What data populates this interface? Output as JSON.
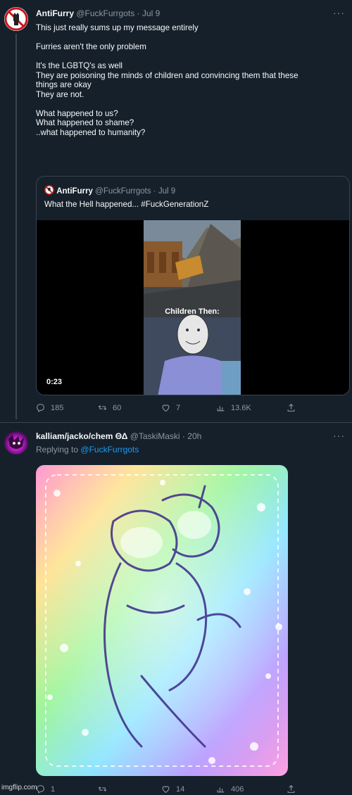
{
  "tweet1": {
    "name": "AntiFurry",
    "handle": "@FuckFurrgots",
    "date": "Jul 9",
    "more": "···",
    "lines": [
      "This just really sums up my message entirely",
      "",
      "Furries aren't the only problem",
      "",
      "It's the LGBTQ's as well",
      "They are poisoning the minds of children and convincing them that these",
      "things are okay",
      "They are not.",
      "",
      "What happened to us?",
      "What happened to shame?",
      "..what happened to humanity?"
    ],
    "quote": {
      "name": "AntiFurry",
      "handle": "@FuckFurrgots",
      "date": "Jul 9",
      "text": "What the Hell happened... #FuckGenerationZ",
      "video_caption": "Children Then:",
      "duration": "0:23"
    },
    "actions": {
      "replies": "185",
      "retweets": "60",
      "likes": "7",
      "views": "13.6K"
    }
  },
  "tweet2": {
    "name": "kalliam/jacko/chem ΘΔ",
    "handle": "@TaskiMaski",
    "date": "20h",
    "more": "···",
    "replying_prefix": "Replying to",
    "replying_to": "@FuckFurrgots",
    "actions": {
      "replies": "1",
      "retweets": "",
      "likes": "14",
      "views": "406"
    }
  },
  "icons": [
    "no-furry-avatar-icon",
    "reply-icon",
    "retweet-icon",
    "like-icon",
    "views-icon",
    "share-icon"
  ],
  "colors": {
    "background": "#15202b",
    "muted": "#8b98a5",
    "link": "#1d9bf0",
    "border": "#38444d"
  },
  "watermark": "imgflip.com"
}
